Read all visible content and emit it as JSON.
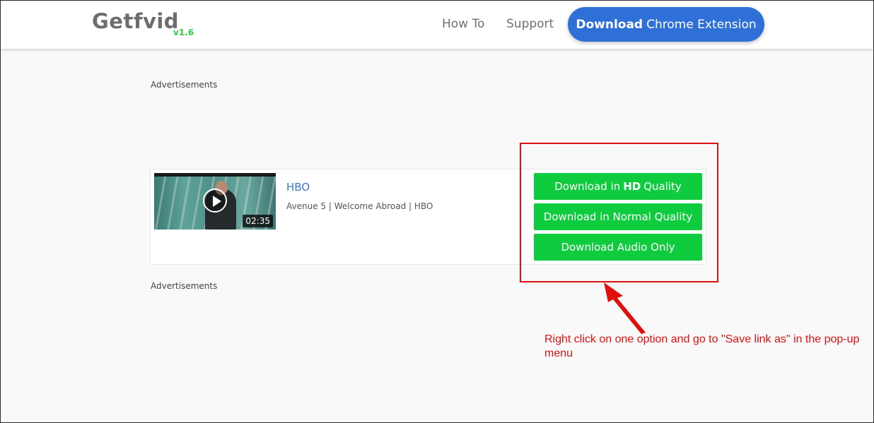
{
  "header": {
    "logo": "Getfvid",
    "version": "v1.6",
    "nav": {
      "how_to": "How To",
      "support": "Support"
    },
    "chrome_button": {
      "bold": "Download",
      "rest": "Chrome Extension"
    }
  },
  "ads": {
    "top_label": "Advertisements",
    "bottom_label": "Advertisements"
  },
  "result": {
    "title": "HBO",
    "description": "Avenue 5 | Welcome Abroad | HBO",
    "duration": "02:35",
    "buttons": {
      "hd": {
        "prefix": "Download in",
        "bold": "HD",
        "suffix": "Quality"
      },
      "normal": "Download in Normal Quality",
      "audio": "Download Audio Only"
    }
  },
  "annotation": {
    "note": "Right click on one option and go to \"Save link as\" in the pop-up menu"
  },
  "colors": {
    "brand_blue": "#2f6fd8",
    "download_green": "#0fcc3e",
    "version_green": "#2ecc40",
    "annotation_red": "#e01010",
    "link_blue": "#3a76c4"
  },
  "icons": [
    "play-icon",
    "arrow-icon"
  ]
}
